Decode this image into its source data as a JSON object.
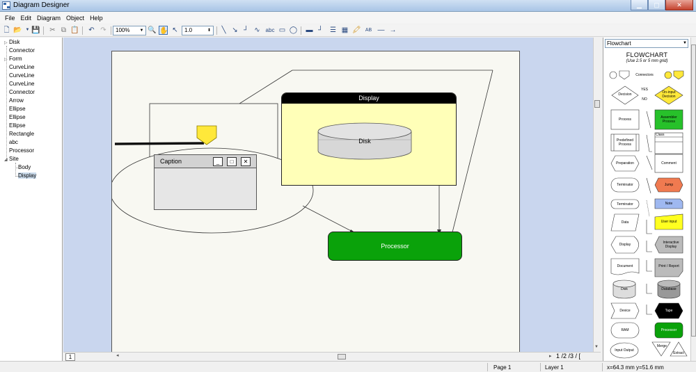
{
  "window": {
    "title": "Diagram Designer"
  },
  "menu": [
    "File",
    "Edit",
    "Diagram",
    "Object",
    "Help"
  ],
  "toolbar": {
    "zoom": "100%",
    "line_width": "1.0",
    "text_tool": "abc"
  },
  "tree": {
    "items": [
      "Disk",
      "Connector",
      "Form",
      "CurveLine",
      "CurveLine",
      "CurveLine",
      "Connector",
      "Arrow",
      "Ellipse",
      "Ellipse",
      "Ellipse",
      "Rectangle",
      "abc",
      "Processor",
      "Site",
      "Body",
      "Display"
    ]
  },
  "diagram": {
    "display_title": "Display",
    "disk_label": "Disk",
    "caption_title": "Caption",
    "processor_label": "Processor",
    "cap_buttons": {
      "min": "_",
      "max": "□",
      "close": "✕"
    }
  },
  "palette": {
    "selected": "Flowchart",
    "title": "FLOWCHART",
    "subtitle": "(Use 2.5 or 5 mm grid)",
    "labels": {
      "connectors": "Connectors",
      "decision": "Decision",
      "yes": "YES",
      "no": "NO",
      "on_input_decision": "On-input Decision",
      "process": "Process",
      "assembler_process": "Assembler Process",
      "predefined_process": "Predefined Process",
      "class": "Class",
      "preparation": "Preparation",
      "comment": "Comment",
      "terminator": "Terminator",
      "jump": "Jump",
      "terminator2": "Terminator",
      "note": "Note",
      "data": "Data",
      "user_input": "User input",
      "display": "Display",
      "interactive_display": "Interactive Display",
      "document": "Document",
      "print_report": "Print / Report",
      "disk": "Disk",
      "database": "Database",
      "device": "Device",
      "tape": "Tape",
      "ram": "RAM",
      "processor": "Processor",
      "input_output": "Input Output",
      "merge": "Merge",
      "extract": "Extract"
    }
  },
  "hscroll": {
    "sheet_tab": "1",
    "page_tabs": "1 /2 /3 /",
    "page_tab_end": "["
  },
  "status": {
    "page": "Page 1",
    "layer": "Layer 1",
    "coords": "x=64.3 mm  y=51.6 mm"
  },
  "colors": {
    "processor": "#0aa20a",
    "display_body": "#ffffb8",
    "connector_yellow": "#ffe83a",
    "canvas_bg": "#c9d6ee",
    "jump": "#f07a50",
    "note": "#9fb8f0",
    "user_input": "#ffff20",
    "assembler": "#27c12a"
  }
}
